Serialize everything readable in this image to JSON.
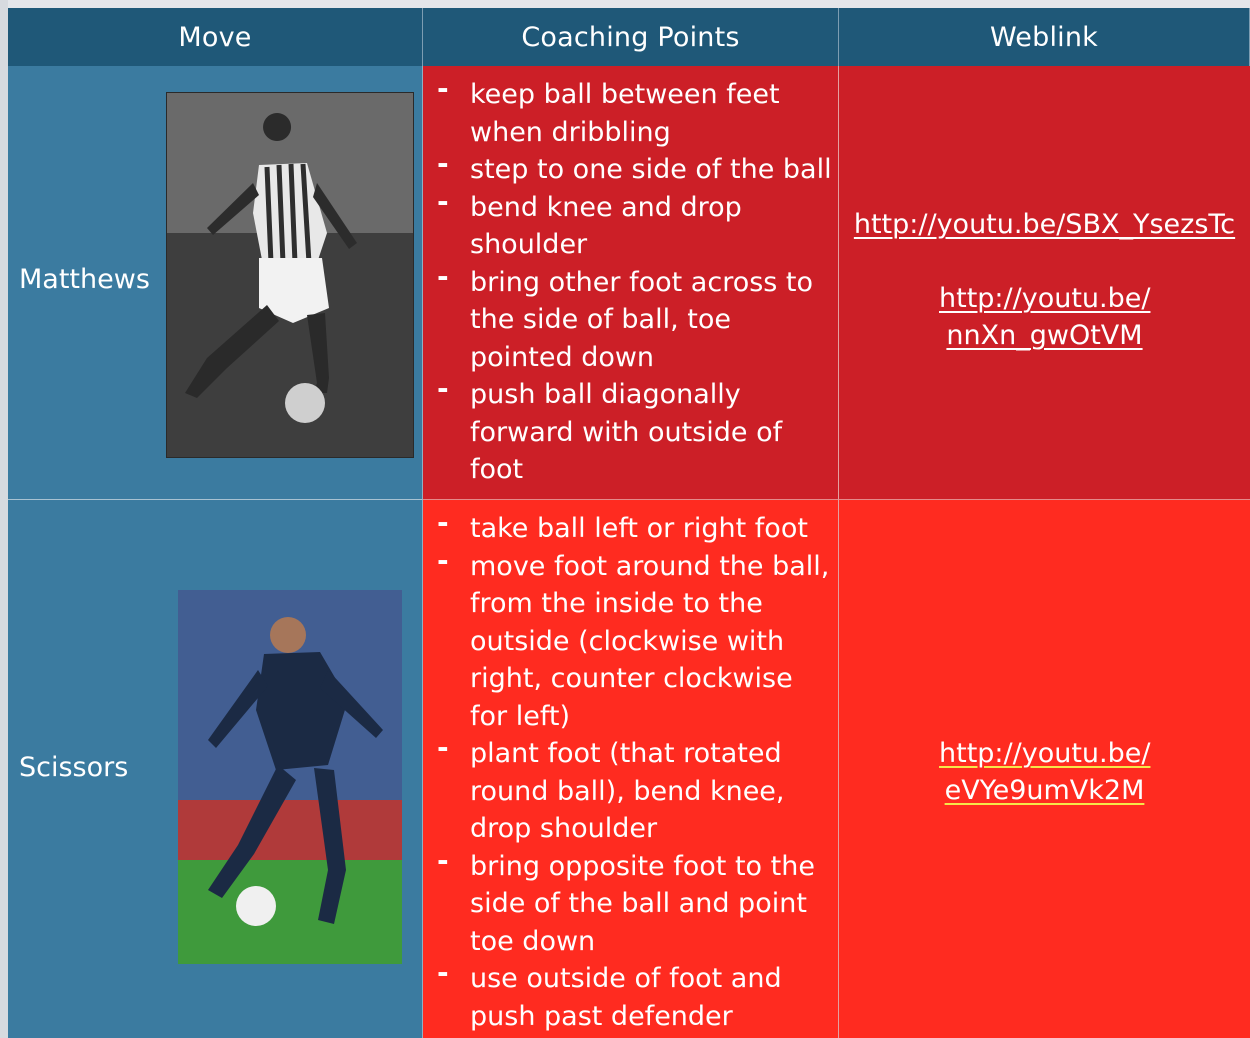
{
  "header": {
    "move": "Move",
    "coaching_points": "Coaching Points",
    "weblink": "Weblink"
  },
  "rows": [
    {
      "move": "Matthews",
      "points": [
        "keep ball between feet when dribbling",
        "step to one side of the ball",
        "bend knee and drop shoulder",
        "bring other foot across to the side of ball, toe pointed down",
        "push ball diagonally forward with outside of foot"
      ],
      "links": [
        "http://youtu.be/SBX_YsezsTc",
        "http://youtu.be/ nnXn_gwOtVM"
      ]
    },
    {
      "move": "Scissors",
      "points": [
        "take ball left or right foot",
        "move foot around the ball, from the inside to the outside (clockwise with right, counter clockwise for left)",
        "plant foot (that rotated round ball), bend knee, drop shoulder",
        "bring opposite foot to the side of the ball and point toe down",
        "use outside of foot and push past defender"
      ],
      "links": [
        "http://youtu.be/ eVYe9umVk2M"
      ]
    }
  ],
  "colors": {
    "header_bg": "#1f5878",
    "move_bg": "#3b7ba0",
    "row1_red": "#cc1f27",
    "row2_red": "#ff2b20"
  }
}
